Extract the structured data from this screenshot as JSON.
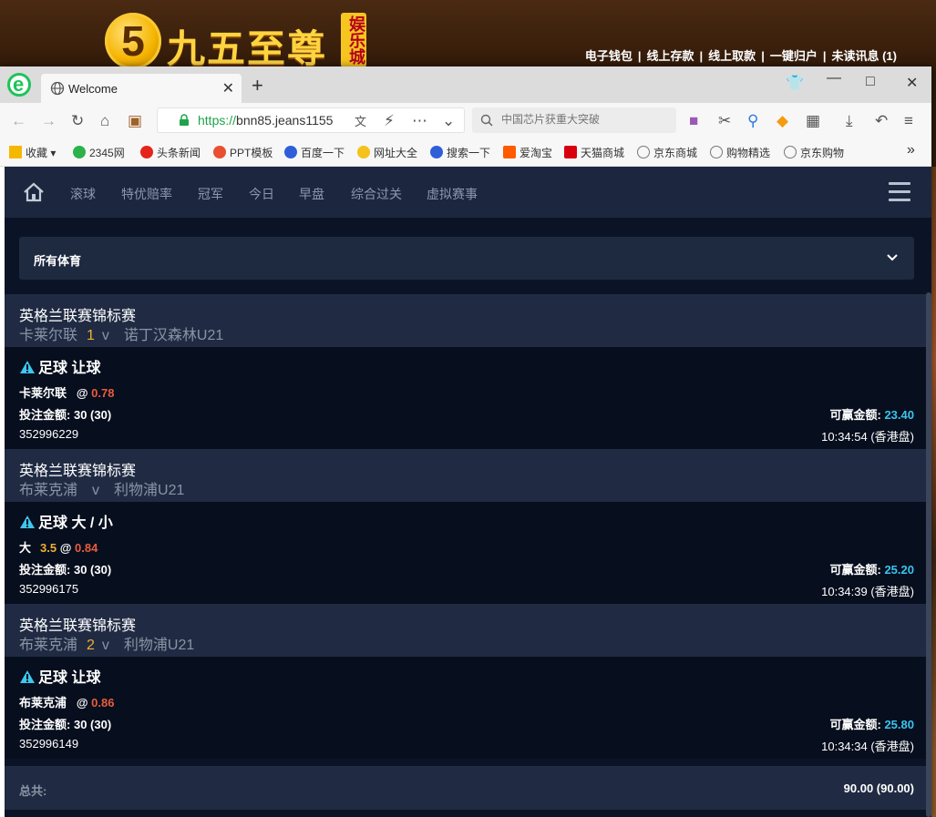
{
  "site": {
    "logo_glyph": "5",
    "name": "九五至尊",
    "badge": "娱乐城",
    "nav": [
      "电子钱包",
      "线上存款",
      "线上取款",
      "一键归户",
      "未读讯息 (1)"
    ],
    "nav_separator": "|"
  },
  "browser": {
    "app_logo_glyph": "e",
    "tab_title": "Welcome",
    "tab_close": "✕",
    "new_tab": "+",
    "url_scheme": "https://",
    "url_rest": "bnn85.jeans1155",
    "search_placeholder": "中国芯片获重大突破",
    "bookmarks": [
      "收藏",
      "2345网",
      "头条新闻",
      "PPT模板",
      "百度一下",
      "网址大全",
      "搜索一下",
      "爱淘宝",
      "天猫商城",
      "京东商城",
      "购物精选",
      "京东购物"
    ],
    "bookmark_more": "»"
  },
  "page": {
    "nav_items": [
      "滚球",
      "特优赔率",
      "冠军",
      "今日",
      "早盘",
      "综合过关",
      "虚拟赛事"
    ],
    "sport_select": "所有体育",
    "bets": [
      {
        "league": "英格兰联赛锦标赛",
        "home": "卡莱尔联",
        "score": "1",
        "vs": "v",
        "away": "诺丁汉森林U21",
        "title": "足球 让球",
        "selection": "卡莱尔联",
        "line": "",
        "at": "@",
        "odds": "0.78",
        "stake_label": "投注金额:",
        "stake": "30 (30)",
        "win_label": "可赢金额:",
        "win": "23.40",
        "id": "352996229",
        "time": "10:34:54 (香港盘)"
      },
      {
        "league": "英格兰联赛锦标赛",
        "home": "布莱克浦",
        "score": "",
        "vs": "v",
        "away": "利物浦U21",
        "title": "足球 大 / 小",
        "selection": "大",
        "line": "3.5",
        "at": "@",
        "odds": "0.84",
        "stake_label": "投注金额:",
        "stake": "30 (30)",
        "win_label": "可赢金额:",
        "win": "25.20",
        "id": "352996175",
        "time": "10:34:39 (香港盘)"
      },
      {
        "league": "英格兰联赛锦标赛",
        "home": "布莱克浦",
        "score": "2",
        "vs": "v",
        "away": "利物浦U21",
        "title": "足球 让球",
        "selection": "布莱克浦",
        "line": "",
        "at": "@",
        "odds": "0.86",
        "stake_label": "投注金额:",
        "stake": "30 (30)",
        "win_label": "可赢金额:",
        "win": "25.80",
        "id": "352996149",
        "time": "10:34:34 (香港盘)"
      }
    ],
    "total_label": "总共:",
    "total_value": "90.00 (90.00)"
  },
  "colors": {
    "page_bg": "#0b1426",
    "header_row": "#202b43",
    "odds": "#e85c3c",
    "line": "#f0b030",
    "win_amount": "#39c6f0",
    "url_green": "#1ea34a"
  },
  "icons": [
    "home-icon",
    "menu-icon",
    "warning-icon",
    "chevron-down-icon",
    "globe-icon",
    "lock-icon",
    "search-icon"
  ]
}
